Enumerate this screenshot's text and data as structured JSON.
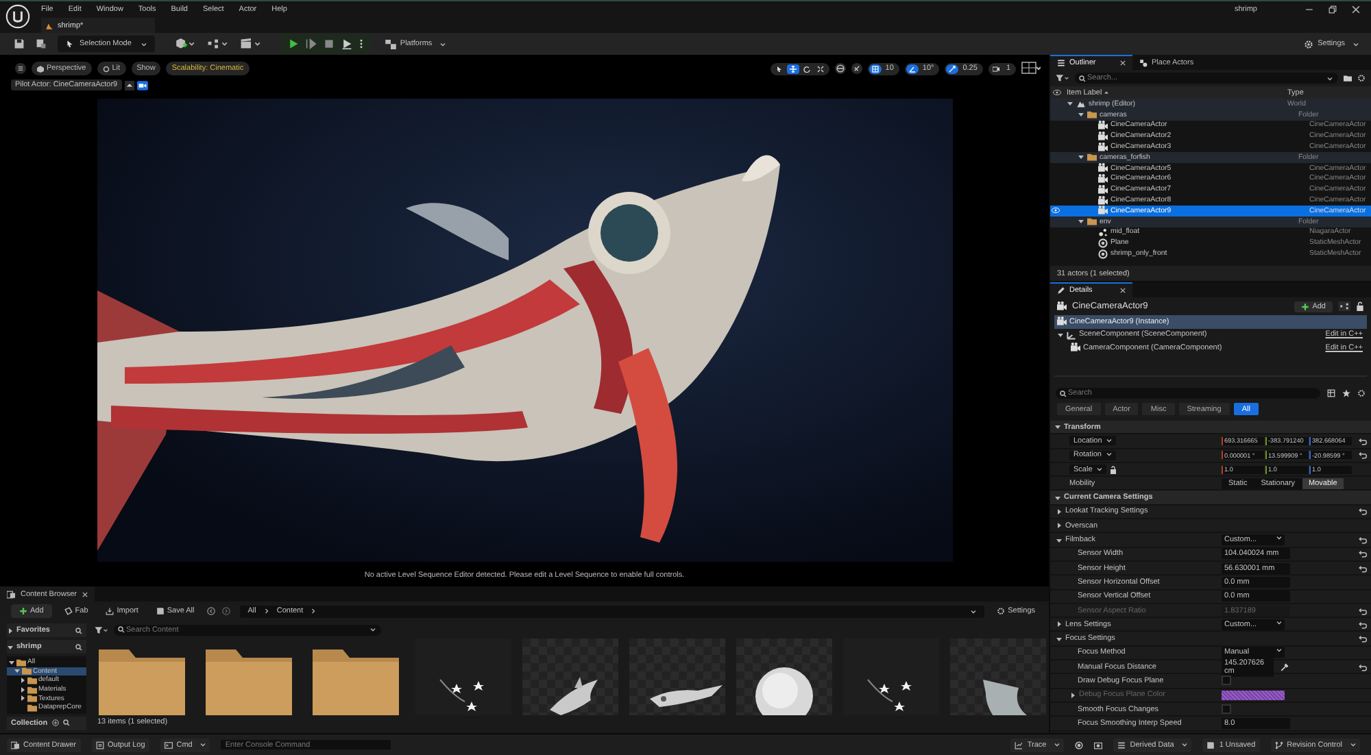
{
  "menu": [
    "File",
    "Edit",
    "Window",
    "Tools",
    "Build",
    "Select",
    "Actor",
    "Help"
  ],
  "window_title": "shrimp",
  "doc_tab": "shrimp*",
  "toolbar": {
    "mode": "Selection Mode",
    "platforms": "Platforms",
    "settings": "Settings"
  },
  "viewport": {
    "view_buttons": [
      {
        "label": "Perspective",
        "kind": "perspective"
      },
      {
        "label": "Lit",
        "kind": "lit"
      },
      {
        "label": "Show",
        "kind": "plain"
      },
      {
        "label": "Scalability: Cinematic",
        "kind": "warning"
      }
    ],
    "transform_tools": [
      {
        "kind": "select",
        "selected": false
      },
      {
        "kind": "move",
        "selected": true
      },
      {
        "kind": "rotate",
        "selected": false
      },
      {
        "kind": "scale",
        "selected": false
      }
    ],
    "snaps": [
      {
        "kind": "grid",
        "value": "10",
        "on": true
      },
      {
        "kind": "angle",
        "value": "10°",
        "on": true
      },
      {
        "kind": "scale",
        "value": "0.25",
        "on": true
      },
      {
        "kind": "camera",
        "value": "1",
        "on": false
      }
    ],
    "pilot": "Pilot Actor: CineCameraActor9",
    "message": "No active Level Sequence Editor detected. Please edit a Level Sequence to enable full controls."
  },
  "outliner": {
    "tabs": [
      {
        "label": "Outliner",
        "selected": true
      },
      {
        "label": "Place Actors",
        "selected": false
      }
    ],
    "search_placeholder": "Search...",
    "columns": [
      "Item Label",
      "Type"
    ],
    "tree": [
      {
        "label": "shrimp (Editor)",
        "type": "World",
        "kind": "world",
        "expanded": true,
        "selected": false,
        "children": [
          {
            "label": "cameras",
            "type": "Folder",
            "kind": "folder",
            "expanded": true,
            "selected": false,
            "children": [
              {
                "label": "CineCameraActor",
                "type": "CineCameraActor",
                "kind": "camera",
                "selected": false
              },
              {
                "label": "CineCameraActor2",
                "type": "CineCameraActor",
                "kind": "camera",
                "selected": false
              },
              {
                "label": "CineCameraActor3",
                "type": "CineCameraActor",
                "kind": "camera",
                "selected": false
              }
            ]
          },
          {
            "label": "cameras_forfish",
            "type": "Folder",
            "kind": "folder",
            "expanded": true,
            "selected": false,
            "children": [
              {
                "label": "CineCameraActor5",
                "type": "CineCameraActor",
                "kind": "camera",
                "selected": false
              },
              {
                "label": "CineCameraActor6",
                "type": "CineCameraActor",
                "kind": "camera",
                "selected": false
              },
              {
                "label": "CineCameraActor7",
                "type": "CineCameraActor",
                "kind": "camera",
                "selected": false
              },
              {
                "label": "CineCameraActor8",
                "type": "CineCameraActor",
                "kind": "camera",
                "selected": false
              },
              {
                "label": "CineCameraActor9",
                "type": "CineCameraActor",
                "kind": "camera",
                "selected": true
              }
            ]
          },
          {
            "label": "env",
            "type": "Folder",
            "kind": "folder",
            "expanded": true,
            "selected": false,
            "children": [
              {
                "label": "mid_float",
                "type": "NiagaraActor",
                "kind": "particle",
                "selected": false
              },
              {
                "label": "Plane",
                "type": "StaticMeshActor",
                "kind": "mesh",
                "selected": false
              },
              {
                "label": "shrimp_only_front",
                "type": "StaticMeshActor",
                "kind": "mesh",
                "selected": false
              }
            ]
          }
        ]
      }
    ],
    "footer": "31 actors (1 selected)"
  },
  "details": {
    "tab": "Details",
    "actor": "CineCameraActor9",
    "add": "Add",
    "components": [
      {
        "label": "CineCameraActor9 (Instance)",
        "kind": "actor",
        "selected": true
      },
      {
        "label": "SceneComponent (SceneComponent)",
        "kind": "scene",
        "selected": false,
        "expanded": true,
        "link": "Edit in C++",
        "children": [
          {
            "label": "CameraComponent (CameraComponent)",
            "kind": "camera",
            "selected": false,
            "link": "Edit in C++"
          }
        ]
      }
    ],
    "search_placeholder": "Search",
    "filters": [
      {
        "label": "General",
        "selected": false
      },
      {
        "label": "Actor",
        "selected": false
      },
      {
        "label": "Misc",
        "selected": false
      },
      {
        "label": "Streaming",
        "selected": false
      },
      {
        "label": "All",
        "selected": true
      }
    ],
    "properties": [
      {
        "kind": "section",
        "label": "Transform",
        "expanded": true,
        "children": [
          {
            "kind": "vector",
            "label": "Location",
            "values": [
              "693.316665",
              "-383.791240",
              "382.668064"
            ],
            "reset": true
          },
          {
            "kind": "vector",
            "label": "Rotation",
            "values": [
              "0.000001 °",
              "13.599909 °",
              "-20.98599 °"
            ],
            "reset": true
          },
          {
            "kind": "vector",
            "label": "Scale",
            "values": [
              "1.0",
              "1.0",
              "1.0"
            ],
            "locked": false,
            "reset": false
          },
          {
            "kind": "mobility",
            "label": "Mobility",
            "options": [
              {
                "label": "Static",
                "selected": false
              },
              {
                "label": "Stationary",
                "selected": false
              },
              {
                "label": "Movable",
                "selected": true
              }
            ]
          }
        ]
      },
      {
        "kind": "section",
        "label": "Current Camera Settings",
        "expanded": true,
        "children": [
          {
            "kind": "group",
            "label": "Lookat Tracking Settings",
            "expanded": false,
            "reset": true
          },
          {
            "kind": "group",
            "label": "Overscan",
            "expanded": false,
            "reset": false
          },
          {
            "kind": "dropdown",
            "label": "Filmback",
            "value": "Custom...",
            "expanded": true,
            "reset": true,
            "children": [
              {
                "kind": "text",
                "label": "Sensor Width",
                "value": "104.040024 mm",
                "reset": true
              },
              {
                "kind": "text",
                "label": "Sensor Height",
                "value": "56.630001 mm",
                "reset": true
              },
              {
                "kind": "text",
                "label": "Sensor Horizontal Offset",
                "value": "0.0 mm",
                "reset": false
              },
              {
                "kind": "text",
                "label": "Sensor Vertical Offset",
                "value": "0.0 mm",
                "reset": false
              },
              {
                "kind": "text",
                "label": "Sensor Aspect Ratio",
                "value": "1.837189",
                "disabled": true,
                "reset": true
              }
            ]
          },
          {
            "kind": "dropdown",
            "label": "Lens Settings",
            "value": "Custom...",
            "expanded": false,
            "reset": true
          },
          {
            "kind": "group",
            "label": "Focus Settings",
            "expanded": true,
            "reset": true,
            "children": [
              {
                "kind": "dropdown",
                "label": "Focus Method",
                "value": "Manual",
                "reset": false
              },
              {
                "kind": "picker",
                "label": "Manual Focus Distance",
                "value": "145.207626 cm",
                "reset": true
              },
              {
                "kind": "checkbox",
                "label": "Draw Debug Focus Plane",
                "checked": false,
                "reset": false
              },
              {
                "kind": "color",
                "label": "Debug Focus Plane Color",
                "color": "#7c3fae",
                "expanded": false,
                "disabled": true,
                "reset": false
              },
              {
                "kind": "checkbox",
                "label": "Smooth Focus Changes",
                "checked": false,
                "reset": false
              },
              {
                "kind": "text",
                "label": "Focus Smoothing Interp Speed",
                "value": "8.0",
                "reset": false
              }
            ]
          }
        ]
      }
    ]
  },
  "content_browser": {
    "tab": "Content Browser",
    "buttons": [
      {
        "label": "Add",
        "kind": "add"
      },
      {
        "label": "Fab",
        "kind": "fab"
      },
      {
        "label": "Import",
        "kind": "import"
      },
      {
        "label": "Save All",
        "kind": "save"
      }
    ],
    "path": [
      "All",
      "Content"
    ],
    "settings": "Settings",
    "sections": [
      {
        "label": "Favorites",
        "expanded": false
      },
      {
        "label": "shrimp",
        "expanded": true
      }
    ],
    "folders": [
      {
        "label": "All",
        "expanded": true,
        "selected": false,
        "children": [
          {
            "label": "Content",
            "expanded": true,
            "selected": true,
            "children": [
              {
                "label": "default",
                "expanded": false,
                "selected": false
              },
              {
                "label": "Materials",
                "expanded": false,
                "selected": false
              },
              {
                "label": "Textures",
                "expanded": false,
                "selected": false
              },
              {
                "label": "DataprepCore",
                "selected": false
              }
            ]
          }
        ]
      }
    ],
    "collections": "Collection",
    "search_placeholder": "Search Content",
    "assets": [
      {
        "kind": "folder"
      },
      {
        "kind": "folder"
      },
      {
        "kind": "folder"
      },
      {
        "kind": "effect"
      },
      {
        "kind": "shark"
      },
      {
        "kind": "fish"
      },
      {
        "kind": "sphere"
      },
      {
        "kind": "effect"
      },
      {
        "kind": "cloth"
      }
    ],
    "footer": "13 items (1 selected)"
  },
  "status_bar": {
    "left": [
      {
        "label": "Content Drawer",
        "kind": "drawer"
      },
      {
        "label": "Output Log",
        "kind": "log"
      },
      {
        "label": "Cmd",
        "kind": "cmd"
      }
    ],
    "console_placeholder": "Enter Console Command",
    "right": [
      {
        "label": "Trace",
        "kind": "trace"
      },
      {
        "label": "Derived Data",
        "kind": "data"
      },
      {
        "label": "1 Unsaved",
        "kind": "unsaved"
      },
      {
        "label": "Revision Control",
        "kind": "revision"
      }
    ]
  }
}
